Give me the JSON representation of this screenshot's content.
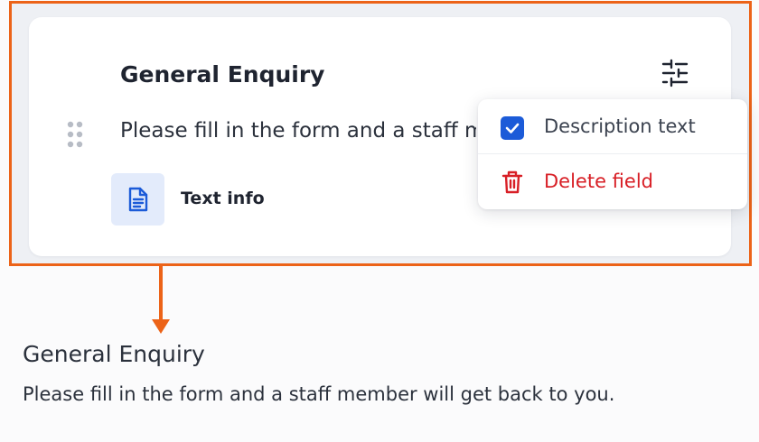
{
  "form_field": {
    "title": "General Enquiry",
    "description": "Please fill in the form and a staff member will get back to you.",
    "type_label": "Text info",
    "type_icon": "document-text-icon",
    "settings_icon": "sliders-icon",
    "drag_icon": "drag-handle-icon"
  },
  "field_menu": {
    "items": [
      {
        "label": "Description text",
        "icon": "checkbox-checked-icon",
        "checked": true
      },
      {
        "label": "Delete field",
        "icon": "trash-icon",
        "danger": true
      }
    ]
  },
  "preview": {
    "title": "General Enquiry",
    "description": "Please fill in the form and a staff member will get back to you."
  },
  "colors": {
    "highlight": "#ec6318",
    "accent": "#1c5bd8",
    "danger": "#d81f26",
    "badge_bg": "#e3ebfb"
  }
}
